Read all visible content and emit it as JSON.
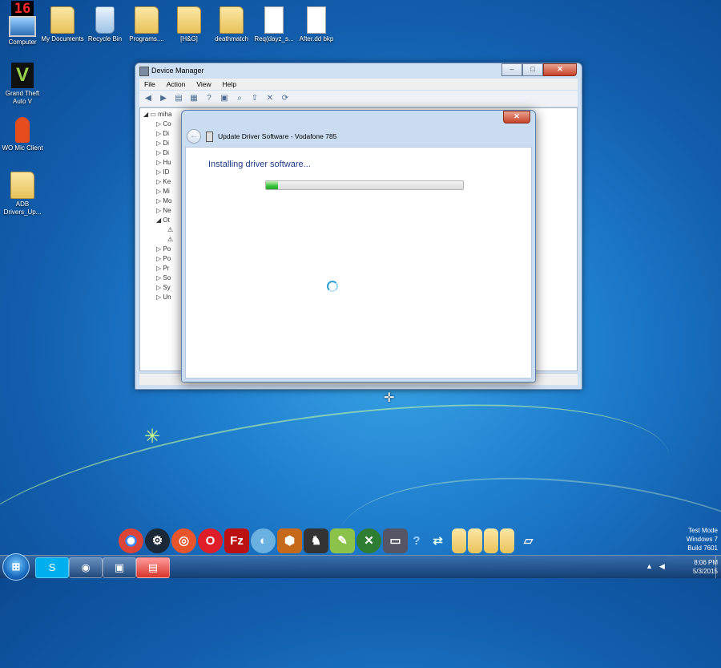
{
  "desktop": {
    "badge": "16",
    "icons": [
      {
        "label": "Computer"
      },
      {
        "label": "My Documents"
      },
      {
        "label": "Recycle Bin"
      },
      {
        "label": "Programs...."
      },
      {
        "label": "[H&G]"
      },
      {
        "label": "deathmatch"
      },
      {
        "label": "Req(dayz_s..."
      },
      {
        "label": "After.dd bkp"
      },
      {
        "label": "Grand Theft Auto V"
      },
      {
        "label": "WO Mic Client"
      },
      {
        "label": "ADB Drivers_Up..."
      }
    ]
  },
  "device_manager": {
    "title": "Device Manager",
    "menu": [
      "File",
      "Action",
      "View",
      "Help"
    ],
    "tree_root": "miha",
    "tree_items": [
      "Co",
      "Di",
      "Di",
      "Di",
      "Hu",
      "ID",
      "Ke",
      "Mi",
      "Mo",
      "Ne",
      "Ot",
      "",
      "",
      "Po",
      "Po",
      "Pr",
      "So",
      "Sy",
      "Un"
    ]
  },
  "update_dialog": {
    "title": "Update Driver Software - Vodafone 785",
    "status": "Installing driver software...",
    "progress_fraction": 0.06
  },
  "taskbar": {
    "start_glyph": "⊞",
    "time": "8:06 PM",
    "date": "5/3/2015"
  },
  "watermark": {
    "line1": "Test Mode",
    "line2": "Windows 7",
    "line3": "Build 7601"
  }
}
